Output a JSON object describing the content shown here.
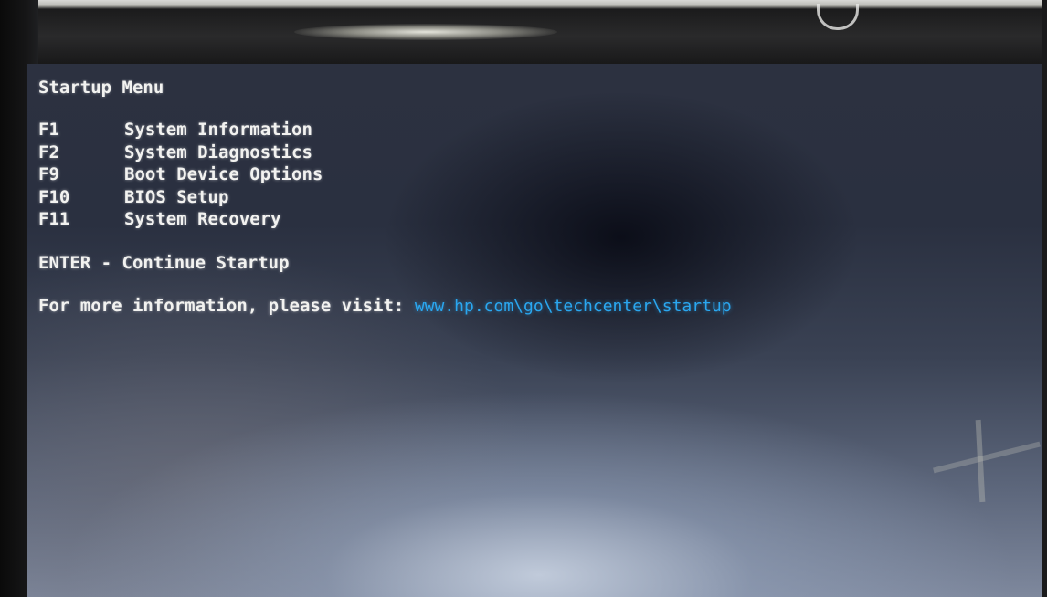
{
  "menu": {
    "title": "Startup Menu",
    "items": [
      {
        "key": "F1",
        "label": "System Information"
      },
      {
        "key": "F2",
        "label": "System Diagnostics"
      },
      {
        "key": "F9",
        "label": "Boot Device Options"
      },
      {
        "key": "F10",
        "label": "BIOS Setup"
      },
      {
        "key": "F11",
        "label": "System Recovery"
      }
    ],
    "enter_text": "ENTER - Continue Startup",
    "info_text": "For more information, please visit: ",
    "info_url": "www.hp.com\\go\\techcenter\\startup"
  },
  "colors": {
    "text": "#f2f2f0",
    "link": "#2aa7f0",
    "screen": "#2c3140"
  }
}
